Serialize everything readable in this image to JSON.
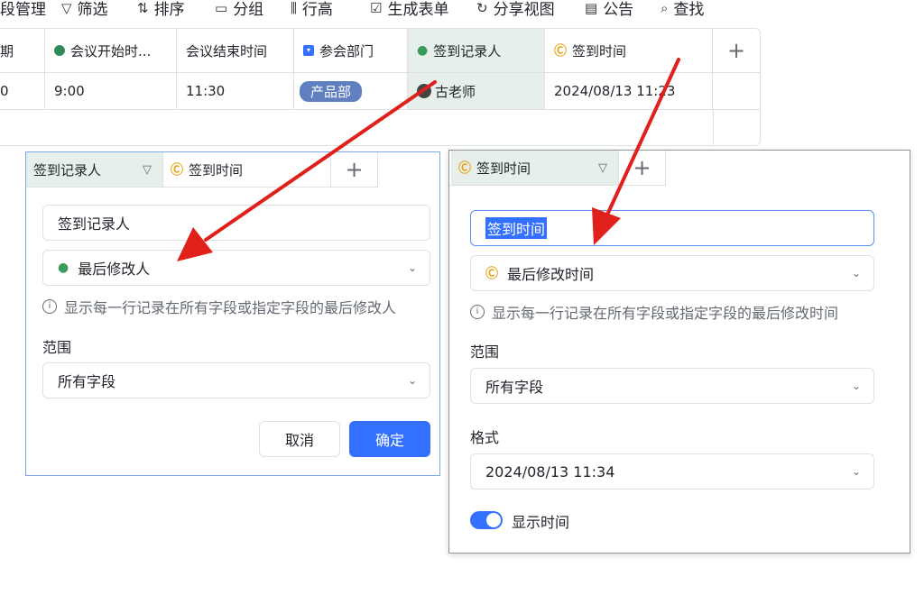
{
  "toolbar": {
    "items": [
      "段管理",
      "筛选",
      "排序",
      "分组",
      "行高",
      "生成表单",
      "分享视图",
      "公告",
      "查找"
    ]
  },
  "grid": {
    "headers": [
      "期",
      "会议开始时...",
      "会议结束时间",
      "参会部门",
      "签到记录人",
      "签到时间",
      "+"
    ],
    "row": {
      "col0": "0",
      "start": "9:00",
      "end": "11:30",
      "dept": "产品部",
      "recorder": "古老师",
      "checkin_time": "2024/08/13 11:23"
    }
  },
  "left_panel": {
    "tabs": [
      "签到记录人",
      "签到时间",
      "+"
    ],
    "name_value": "签到记录人",
    "type_value": "最后修改人",
    "hint": "显示每一行记录在所有字段或指定字段的最后修改人",
    "scope_label": "范围",
    "scope_value": "所有字段",
    "cancel": "取消",
    "confirm": "确定"
  },
  "right_panel": {
    "tabs": [
      "签到时间",
      "+"
    ],
    "name_value": "签到时间",
    "type_value": "最后修改时间",
    "hint": "显示每一行记录在所有字段或指定字段的最后修改时间",
    "scope_label": "范围",
    "scope_value": "所有字段",
    "format_label": "格式",
    "format_value": "2024/08/13 11:34",
    "show_time_label": "显示时间",
    "show_time_on": true
  },
  "colors": {
    "accent": "#3370ff",
    "arrow": "#e0201b",
    "tag": "#5f7fbf"
  }
}
